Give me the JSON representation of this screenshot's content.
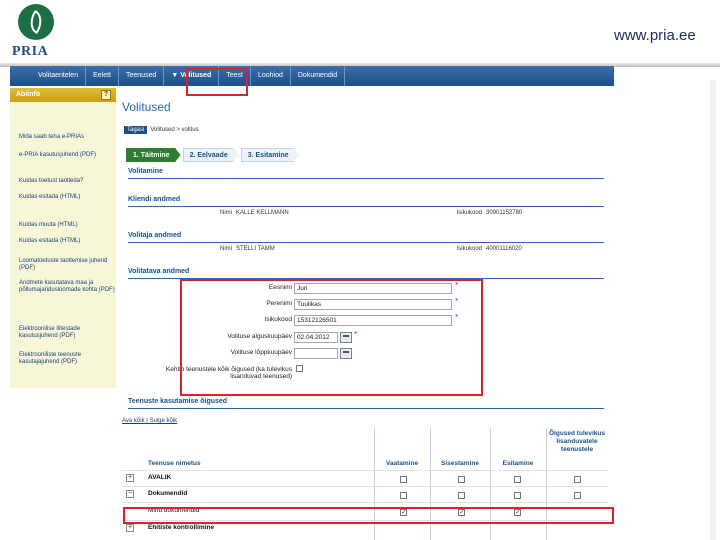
{
  "header": {
    "logo_text": "PRIA",
    "site_url": "www.pria.ee"
  },
  "nav": {
    "items": [
      "Volitaeritelen",
      "Eelett",
      "Teenused",
      "Volitused",
      "Teest",
      "Loohiod",
      "Dokumendid"
    ],
    "active_index": 3
  },
  "left_panel": {
    "title": "Abiinfo",
    "toggle": "?",
    "links": [
      "Mida saab teha e-PRIAs",
      "e-PRIA kasutusjuhend (PDF)",
      "Kuidas toetust taotleda?",
      "Kuidas esitada (HTML)",
      "Kuidas muuta (HTML)",
      "Kuidas esitada (HTML)",
      "Loomatoetuste taotlemise juhend (PDF)",
      "Andmete kasutatava maa ja põllumajandusloomade kohta (PDF)",
      "Elektroonilise liitestade kasutusjuhend (PDF)",
      "Elektrooniliste teenuste kasutajajuhend (PDF)"
    ]
  },
  "main": {
    "title": "Volitused",
    "breadcrumb": {
      "back": "Tagasi",
      "path": "Volitused > volitus"
    },
    "steps": [
      "1. Täitmine",
      "2. Eelvaade",
      "3. Esitamine"
    ],
    "section_volitamine": "Volitamine",
    "kliendi": {
      "title": "Kliendi andmed",
      "name_label": "Nimi",
      "name_value": "KALLE KELLMANN",
      "code_label": "Isikukood",
      "code_value": "30901152780"
    },
    "volitaja": {
      "title": "Volitaja andmed",
      "name_label": "Nimi",
      "name_value": "STELLI TAMM",
      "code_label": "Isikukood",
      "code_value": "40001116020"
    },
    "volitatav": {
      "title": "Volitatava andmed",
      "eesnimi_label": "Eesnimi",
      "eesnimi_value": "Juri",
      "perenimi_label": "Perenimi",
      "perenimi_value": "Tuulikas",
      "isikukood_label": "Isikukood",
      "isikukood_value": "15312126501",
      "algus_label": "Volituse alguskuupäev",
      "algus_value": "02.04.2012",
      "lopp_label": "Volituse lõppkuupäev",
      "lopp_value": "",
      "kehtib_label": "Kehtib teenustele kõik õigused (ka tulevikus lisanduvad teenused)",
      "required_mark": "*"
    },
    "rights": {
      "title": "Teenuste kasutamise õigused",
      "links": [
        "Ava kõik",
        "Sulge kõik"
      ],
      "col_service": "Teenuse nimetus",
      "col_view": "Vaatamine",
      "col_enter": "Sisestamine",
      "col_submit": "Esitamine",
      "col_future": "Õigused tulevikus lisanduvatele teenustele",
      "rows": [
        {
          "toggle": "+",
          "label": "AVALIK",
          "bold": true,
          "checks": [
            false,
            false,
            false,
            false
          ]
        },
        {
          "toggle": "−",
          "label": "Dokumendid",
          "bold": true,
          "checks": [
            false,
            false,
            false,
            false
          ]
        },
        {
          "toggle": "",
          "label": "Minu dokumendid",
          "bold": false,
          "checks": [
            true,
            true,
            true,
            false
          ]
        },
        {
          "toggle": "+",
          "label": "Ehitiste kontrollimine",
          "bold": true,
          "checks": [
            false,
            false,
            false,
            false
          ]
        }
      ]
    }
  }
}
